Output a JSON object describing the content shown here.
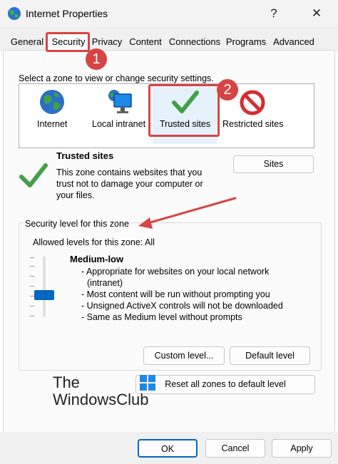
{
  "window": {
    "title": "Internet Properties",
    "help_label": "?",
    "close_label": "✕"
  },
  "tabs": [
    {
      "label": "General"
    },
    {
      "label": "Security"
    },
    {
      "label": "Privacy"
    },
    {
      "label": "Content"
    },
    {
      "label": "Connections"
    },
    {
      "label": "Programs"
    },
    {
      "label": "Advanced"
    }
  ],
  "zones": {
    "prompt": "Select a zone to view or change security settings.",
    "items": [
      {
        "label": "Internet"
      },
      {
        "label": "Local intranet"
      },
      {
        "label": "Trusted sites"
      },
      {
        "label": "Restricted sites"
      }
    ]
  },
  "zone_info": {
    "title": "Trusted sites",
    "desc": [
      "This zone contains websites that you",
      "trust not to damage your computer or",
      "your files."
    ],
    "sites_button": "Sites"
  },
  "security": {
    "group_label": "Security level for this zone",
    "allowed": "Allowed levels for this zone: All",
    "level_name": "Medium-low",
    "level_value": 0.33,
    "desc": [
      "- Appropriate for websites on your local network",
      "(intranet)",
      "- Most content will be run without prompting you",
      "- Unsigned ActiveX controls will not be downloaded",
      "- Same as Medium level without prompts"
    ],
    "custom_button": "Custom level...",
    "default_button": "Default level",
    "reset_button": "Reset all zones to default level"
  },
  "watermark": {
    "line1": "The",
    "line2": "WindowsClub"
  },
  "annotations": {
    "step1": "1",
    "step2": "2"
  },
  "footer": {
    "ok": "OK",
    "cancel": "Cancel",
    "apply": "Apply"
  },
  "colors": {
    "accent": "#0067c0",
    "annotation_red": "#d64545"
  }
}
